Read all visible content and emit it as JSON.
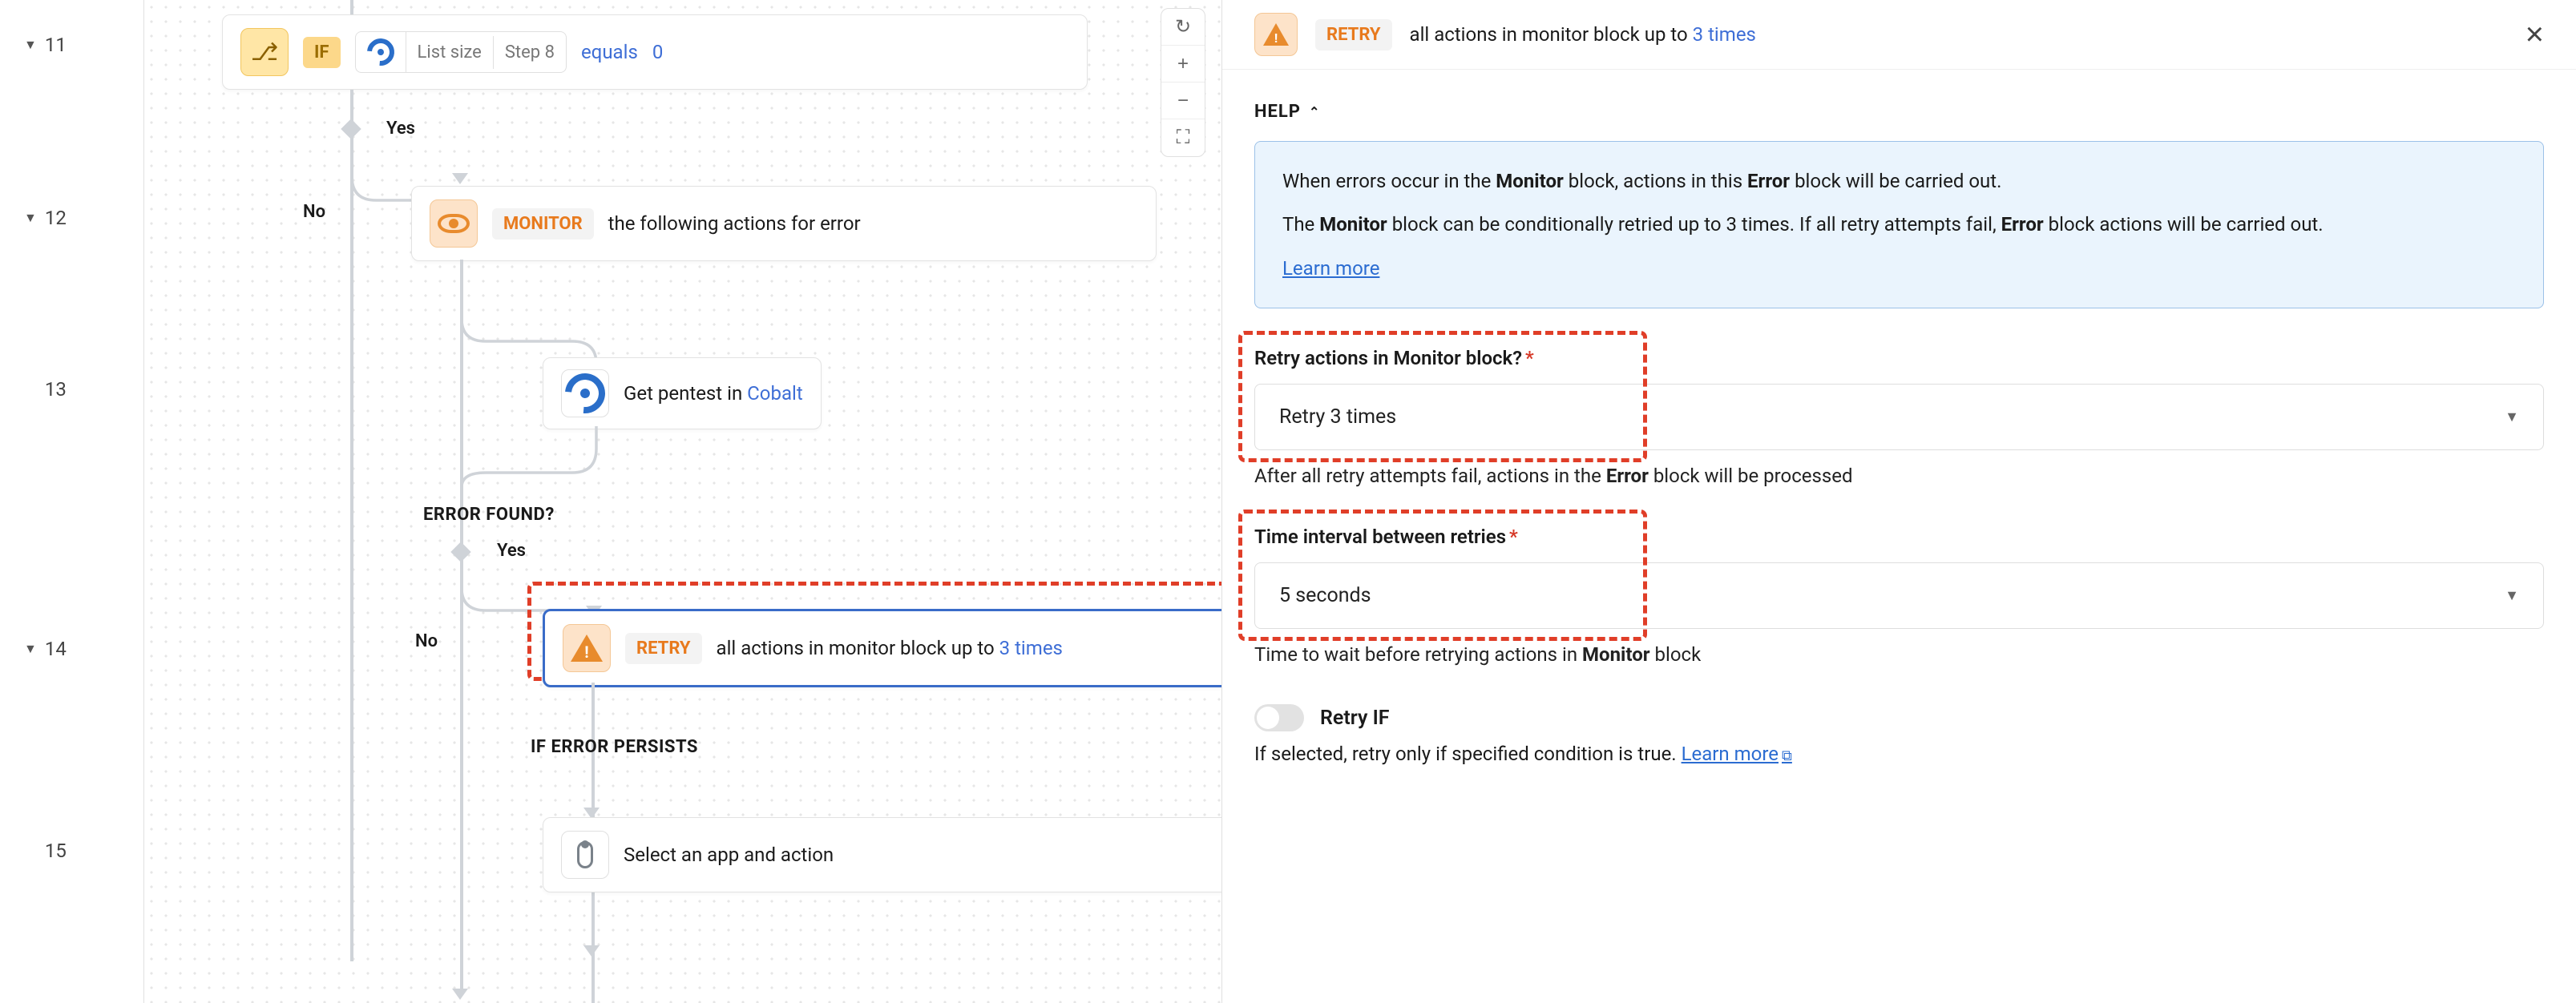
{
  "gutter": {
    "steps": [
      {
        "n": "11",
        "chev": true
      },
      {
        "n": "12",
        "chev": true
      },
      {
        "n": "13",
        "chev": false
      },
      {
        "n": "14",
        "chev": true
      },
      {
        "n": "15",
        "chev": false
      }
    ]
  },
  "canvas": {
    "yes": "Yes",
    "no": "No",
    "if_card": {
      "badge": "IF",
      "list_size": "List size",
      "step": "Step 8",
      "equals": "equals",
      "zero": "0"
    },
    "monitor_card": {
      "badge": "MONITOR",
      "text": "the following actions for error"
    },
    "cobalt_card": {
      "text_prefix": "Get pentest in ",
      "cobalt": "Cobalt"
    },
    "error_found": "ERROR FOUND?",
    "retry_card": {
      "badge": "RETRY",
      "text_prefix": "all actions in monitor block up to ",
      "times": "3 times"
    },
    "error_persists": "IF ERROR PERSISTS",
    "select_card": {
      "text": "Select an app and action"
    }
  },
  "panel": {
    "header": {
      "badge": "RETRY",
      "text_prefix": "all actions in monitor block up to ",
      "times": "3 times"
    },
    "help_label": "HELP",
    "help": {
      "p1_a": "When errors occur in the ",
      "p1_b": "Monitor",
      "p1_c": " block, actions in this ",
      "p1_d": "Error",
      "p1_e": " block will be carried out.",
      "p2_a": "The ",
      "p2_b": "Monitor",
      "p2_c": " block can be conditionally retried up to 3 times. If all retry attempts fail, ",
      "p2_d": "Error",
      "p2_e": " block actions will be carried out.",
      "learn_more": "Learn more"
    },
    "field_retry": {
      "label": "Retry actions in Monitor block?",
      "value": "Retry 3 times",
      "hint_a": "After all retry attempts fail, actions in the ",
      "hint_b": "Error",
      "hint_c": " block will be processed"
    },
    "field_interval": {
      "label": "Time interval between retries",
      "value": "5 seconds",
      "hint_a": "Time to wait before retrying actions in ",
      "hint_b": "Monitor",
      "hint_c": " block"
    },
    "retry_if": {
      "label": "Retry IF",
      "desc": "If selected, retry only if specified condition is true.",
      "learn_more": "Learn more"
    }
  }
}
